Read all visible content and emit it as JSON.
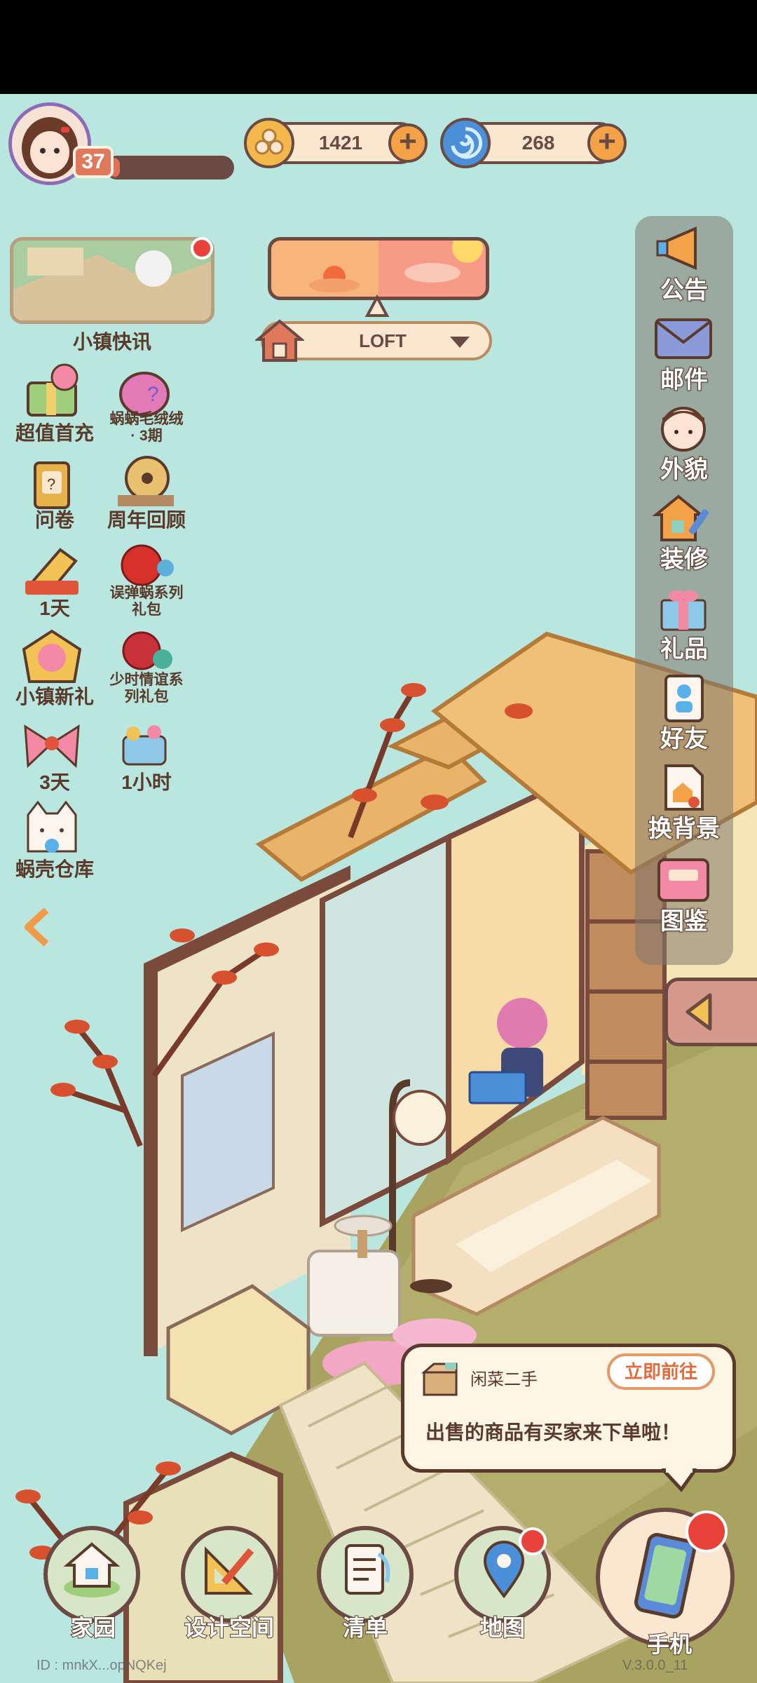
{
  "player": {
    "level": "37",
    "xp_fraction": 0.1
  },
  "currencies": [
    {
      "name": "coin",
      "value": "1421",
      "icon": "clover-coin-icon",
      "color": "#f3b74c"
    },
    {
      "name": "gem",
      "value": "268",
      "icon": "blue-swirl-icon",
      "color": "#4a8fd8"
    }
  ],
  "news": {
    "label": "小镇快讯"
  },
  "room": {
    "name": "LOFT"
  },
  "left_events": [
    {
      "label": "超值首充",
      "icon": "gift-box-icon"
    },
    {
      "label": "蜗蜗毛绒绒\n· 3期",
      "icon": "plush-snail-icon"
    },
    {
      "label": "问卷",
      "icon": "questionnaire-icon"
    },
    {
      "label": "周年回顾",
      "icon": "film-reel-icon"
    },
    {
      "label": "1天",
      "icon": "ticket-icon"
    },
    {
      "label": "误弹蜗系列\n礼包",
      "icon": "red-flower-icon"
    },
    {
      "label": "小镇新礼",
      "icon": "rose-badge-icon"
    },
    {
      "label": "少时情谊系\n列礼包",
      "icon": "rose-pack-icon"
    },
    {
      "label": "3天",
      "icon": "ribbon-bow-icon"
    },
    {
      "label": "1小时",
      "icon": "gift-basket-icon"
    },
    {
      "label": "蜗壳仓库",
      "icon": "cat-warehouse-icon"
    }
  ],
  "right_menu": [
    {
      "label": "公告",
      "icon": "megaphone-icon"
    },
    {
      "label": "邮件",
      "icon": "mail-icon"
    },
    {
      "label": "外貌",
      "icon": "character-face-icon"
    },
    {
      "label": "装修",
      "icon": "house-wrench-icon"
    },
    {
      "label": "礼品",
      "icon": "gift-icon"
    },
    {
      "label": "好友",
      "icon": "friends-book-icon"
    },
    {
      "label": "换背景",
      "icon": "background-change-icon"
    },
    {
      "label": "图鉴",
      "icon": "album-icon"
    }
  ],
  "notification": {
    "source": "闲菜二手",
    "action": "立即前往",
    "message": "出售的商品有买家来下单啦！"
  },
  "bottom_nav": [
    {
      "label": "家园",
      "icon": "home-icon"
    },
    {
      "label": "设计空间",
      "icon": "design-ruler-icon"
    },
    {
      "label": "清单",
      "icon": "checklist-icon"
    },
    {
      "label": "地图",
      "icon": "map-pin-icon"
    },
    {
      "label": "手机",
      "icon": "phone-icon"
    }
  ],
  "footer": {
    "id": "ID : mnkX...opNQKej",
    "version": "V.3.0.0_11"
  }
}
